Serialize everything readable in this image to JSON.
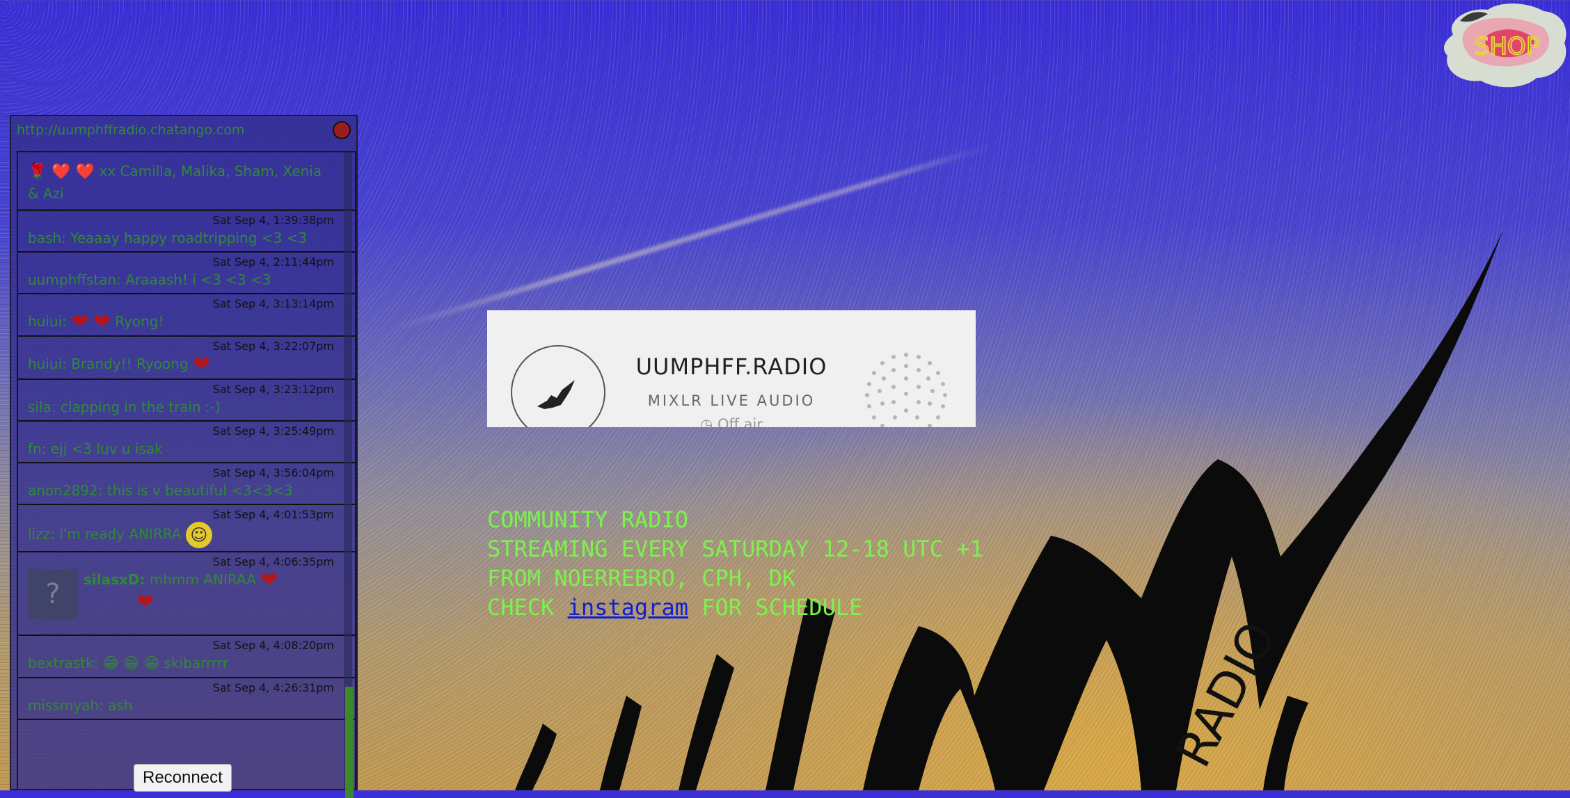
{
  "chat": {
    "url": "http://uumphffradio.chatango.com",
    "messages": [
      {
        "time": "",
        "name": "",
        "text": "xx Camilla, Malika, Sham, Xenia & Azi",
        "decor": "🌹 ❤️ ❤️"
      },
      {
        "time": "Sat Sep 4, 1:39:38pm",
        "name": "bash:",
        "text": "Yeaaay happy roadtripping <3 <3"
      },
      {
        "time": "Sat Sep 4, 2:11:44pm",
        "name": "uumphffstan:",
        "text": "Araaash! i <3 <3 <3"
      },
      {
        "time": "Sat Sep 4, 3:13:14pm",
        "name": "huiui:",
        "text": "Ryong!"
      },
      {
        "time": "Sat Sep 4, 3:22:07pm",
        "name": "huiui:",
        "text": "Brandy!! Ryoong"
      },
      {
        "time": "Sat Sep 4, 3:23:12pm",
        "name": "sila:",
        "text": "clapping in the train :-)"
      },
      {
        "time": "Sat Sep 4, 3:25:49pm",
        "name": "fn:",
        "text": "ejj <3 luv u isak"
      },
      {
        "time": "Sat Sep 4, 3:56:04pm",
        "name": "anon2892:",
        "text": "this is v beautiful <3<3<3"
      },
      {
        "time": "Sat Sep 4, 4:01:53pm",
        "name": "lizz:",
        "text": "i'm ready ANIRRA"
      },
      {
        "time": "Sat Sep 4, 4:06:35pm",
        "name": "silasxD:",
        "text": "mhmm ANIRAA"
      },
      {
        "time": "Sat Sep 4, 4:08:20pm",
        "name": "bextrastk:",
        "text": "skibarrrrr"
      },
      {
        "time": "Sat Sep 4, 4:26:31pm",
        "name": "missmyah:",
        "text": "ash"
      }
    ],
    "reconnect_label": "Reconnect",
    "avatar_placeholder": "?"
  },
  "player": {
    "title": "UUMPHFF.RADIO",
    "subtitle": "MIXLR LIVE AUDIO",
    "status": "Off air",
    "status_icon": "clock-icon"
  },
  "info": {
    "line1": "COMMUNITY RADIO",
    "line2": "STREAMING EVERY SATURDAY 12-18 UTC +1",
    "line3": "FROM NOERREBRO, CPH, DK",
    "line4_prefix": "CHECK",
    "line4_link": "instagram",
    "line4_suffix": "FOR SCHEDULE"
  },
  "colors": {
    "info_text": "#7df24c",
    "link": "#1020d0",
    "chat_text": "#2f8a36",
    "heart": "#b3161c"
  }
}
